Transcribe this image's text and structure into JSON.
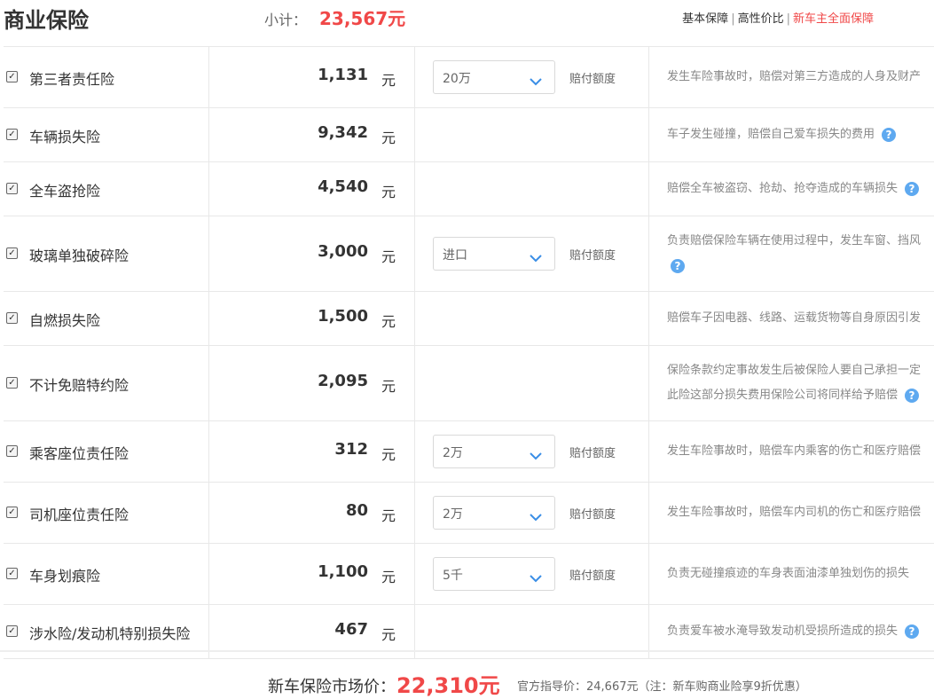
{
  "header": {
    "title": "商业保险",
    "subtotal_label": "小计：",
    "subtotal_value": "23,567元",
    "tabs": [
      {
        "label": "基本保障",
        "active": false
      },
      {
        "label": "高性价比",
        "active": false
      },
      {
        "label": "新车主全面保障",
        "active": true
      }
    ],
    "separator": "|"
  },
  "unit": "元",
  "amount_label": "赔付额度",
  "help_glyph": "?",
  "rows": [
    {
      "name": "第三者责任险",
      "price": "1,131",
      "checked": true,
      "select": "20万",
      "desc": "发生车险事故时，赔偿对第三方造成的人身及财产",
      "help": false
    },
    {
      "name": "车辆损失险",
      "price": "9,342",
      "checked": true,
      "desc": "车子发生碰撞，赔偿自己爱车损失的费用",
      "help": true
    },
    {
      "name": "全车盗抢险",
      "price": "4,540",
      "checked": true,
      "desc": "赔偿全车被盗窃、抢劫、抢夺造成的车辆损失",
      "help": true
    },
    {
      "name": "玻璃单独破碎险",
      "price": "3,000",
      "checked": true,
      "select": "进口",
      "desc": "负责赔偿保险车辆在使用过程中，发生车窗、挡风",
      "help": true
    },
    {
      "name": "自燃损失险",
      "price": "1,500",
      "checked": true,
      "desc": "赔偿车子因电器、线路、运载货物等自身原因引发",
      "help": false
    },
    {
      "name": "不计免赔特约险",
      "price": "2,095",
      "checked": true,
      "desc": "保险条款约定事故发生后被保险人要自己承担一定",
      "desc2": "此险这部分损失费用保险公司将同样给予赔偿",
      "help": true
    },
    {
      "name": "乘客座位责任险",
      "price": "312",
      "checked": true,
      "select": "2万",
      "desc": "发生车险事故时，赔偿车内乘客的伤亡和医疗赔偿",
      "help": false
    },
    {
      "name": "司机座位责任险",
      "price": "80",
      "checked": true,
      "select": "2万",
      "desc": "发生车险事故时，赔偿车内司机的伤亡和医疗赔偿",
      "help": false
    },
    {
      "name": "车身划痕险",
      "price": "1,100",
      "checked": true,
      "select": "5千",
      "desc": "负责无碰撞痕迹的车身表面油漆单独划伤的损失",
      "help": false
    },
    {
      "name": "涉水险/发动机特别损失险",
      "price": "467",
      "checked": true,
      "desc": "负责爱车被水淹导致发动机受损所造成的损失",
      "help": true
    }
  ],
  "footer": {
    "market_label": "新车保险市场价：",
    "market_value": "22,310元",
    "guide_text": "官方指导价：24,667元（注：新车购商业险享9折优惠）"
  },
  "colors": {
    "accent": "#f04848",
    "help_blue": "#5ea9f0",
    "border": "#e8e8e8"
  }
}
